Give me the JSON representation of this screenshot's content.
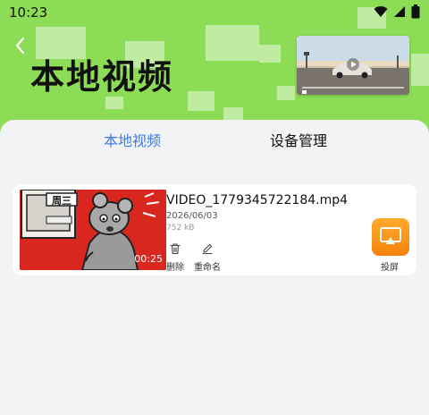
{
  "status_bar": {
    "time": "10:23"
  },
  "header": {
    "title": "本地视频"
  },
  "tabs": [
    {
      "label": "本地视频",
      "active": true
    },
    {
      "label": "设备管理",
      "active": false
    }
  ],
  "videos": [
    {
      "filename": "VIDEO_1779345722184.mp4",
      "date": "2026/06/03",
      "size": "752 kB",
      "duration": "00:25",
      "thumb_text": "周三",
      "actions": {
        "delete": "删除",
        "rename": "重命名"
      },
      "cast_label": "投屏"
    }
  ],
  "colors": {
    "header_bg": "#8cdc55",
    "accent": "#3a7be6",
    "cast": "#f6820c"
  },
  "icons": [
    "back-chevron-icon",
    "wifi-icon",
    "signal-icon",
    "battery-icon",
    "trash-icon",
    "pencil-icon",
    "cast-screen-icon"
  ]
}
